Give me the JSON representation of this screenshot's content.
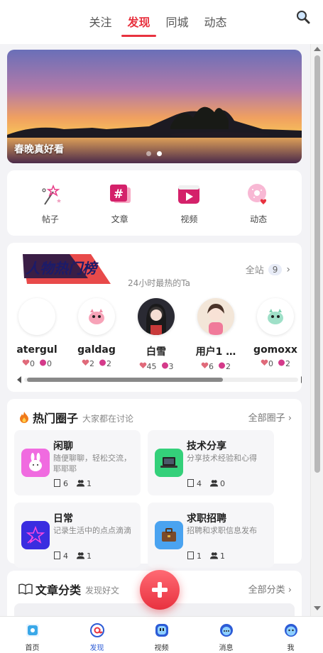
{
  "top_tabs": [
    "关注",
    "发现",
    "同城",
    "动态"
  ],
  "active_tab": 1,
  "banner": {
    "caption": "春晚真好看",
    "slides": 2,
    "active_slide": 1
  },
  "quick_actions": [
    {
      "label": "帖子",
      "icon": "magic-wand-icon"
    },
    {
      "label": "文章",
      "icon": "hashtag-doc-icon"
    },
    {
      "label": "视频",
      "icon": "video-icon"
    },
    {
      "label": "动态",
      "icon": "donut-heart-icon"
    }
  ],
  "ranking": {
    "logo_text": "人物热门榜",
    "subtitle": "24小时最热的Ta",
    "scope_label": "全站",
    "scope_count": "9",
    "users": [
      {
        "name": "atergul",
        "likes": "0",
        "gifts": "0"
      },
      {
        "name": "galdag",
        "likes": "2",
        "gifts": "2"
      },
      {
        "name": "白雪",
        "likes": "45",
        "gifts": "3"
      },
      {
        "name": "用户1 …",
        "likes": "6",
        "gifts": "2"
      },
      {
        "name": "gomoxx",
        "likes": "0",
        "gifts": "2"
      }
    ]
  },
  "circles": {
    "title": "热门圈子",
    "subtitle": "大家都在讨论",
    "more": "全部圈子 ›",
    "items": [
      {
        "name": "闲聊",
        "desc": "随便聊聊，轻松交流，耶耶耶",
        "posts": "6",
        "members": "1",
        "color": "#f06be0"
      },
      {
        "name": "技术分享",
        "desc": "分享技术经验和心得",
        "posts": "4",
        "members": "0",
        "color": "#34d07a"
      },
      {
        "name": "日常",
        "desc": "记录生活中的点点滴滴",
        "posts": "4",
        "members": "1",
        "color": "#3a2de0"
      },
      {
        "name": "求职招聘",
        "desc": "招聘和求职信息发布",
        "posts": "1",
        "members": "1",
        "color": "#4aa3f0"
      }
    ]
  },
  "articles": {
    "title": "文章分类",
    "subtitle": "发现好文",
    "more": "全部分类 ›"
  },
  "bottom_nav": [
    {
      "label": "首页",
      "icon": "home-icon"
    },
    {
      "label": "发现",
      "icon": "at-icon"
    },
    {
      "label": "视频",
      "icon": "video-face-icon"
    },
    {
      "label": "消息",
      "icon": "chat-icon"
    },
    {
      "label": "我",
      "icon": "profile-face-icon"
    }
  ],
  "active_nav": 1,
  "colors": {
    "accent": "#e8323f",
    "nav_active": "#2c5bd6"
  }
}
